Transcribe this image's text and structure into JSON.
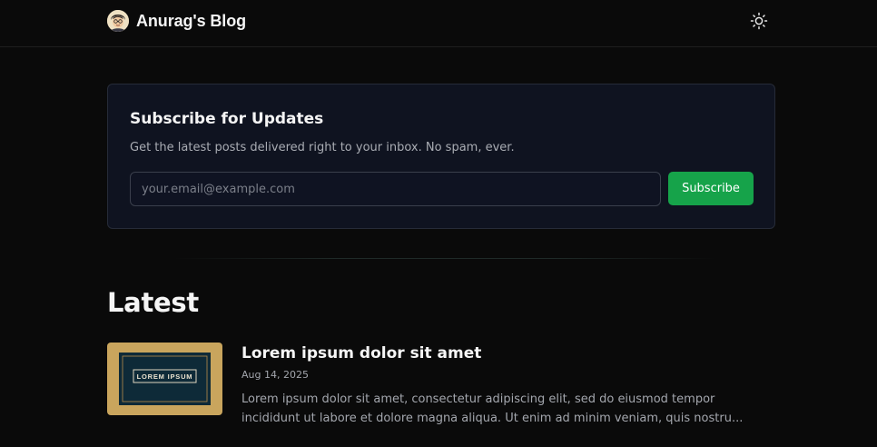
{
  "header": {
    "blog_title": "Anurag's Blog",
    "avatar_icon": "avatar-icon",
    "theme_toggle_icon": "sun-icon"
  },
  "subscribe": {
    "title": "Subscribe for Updates",
    "description": "Get the latest posts delivered right to your inbox. No spam, ever.",
    "email_placeholder": "your.email@example.com",
    "email_value": "",
    "button_label": "Subscribe",
    "button_color": "#16a34a"
  },
  "latest": {
    "heading": "Latest",
    "posts": [
      {
        "title": "Lorem ipsum dolor sit amet",
        "date": "Aug 14, 2025",
        "excerpt": "Lorem ipsum dolor sit amet, consectetur adipiscing elit, sed do eiusmod tempor incididunt ut labore et dolore magna aliqua. Ut enim ad minim veniam, quis nostru...",
        "thumbnail_text": "LOREM IPSUM"
      }
    ]
  }
}
